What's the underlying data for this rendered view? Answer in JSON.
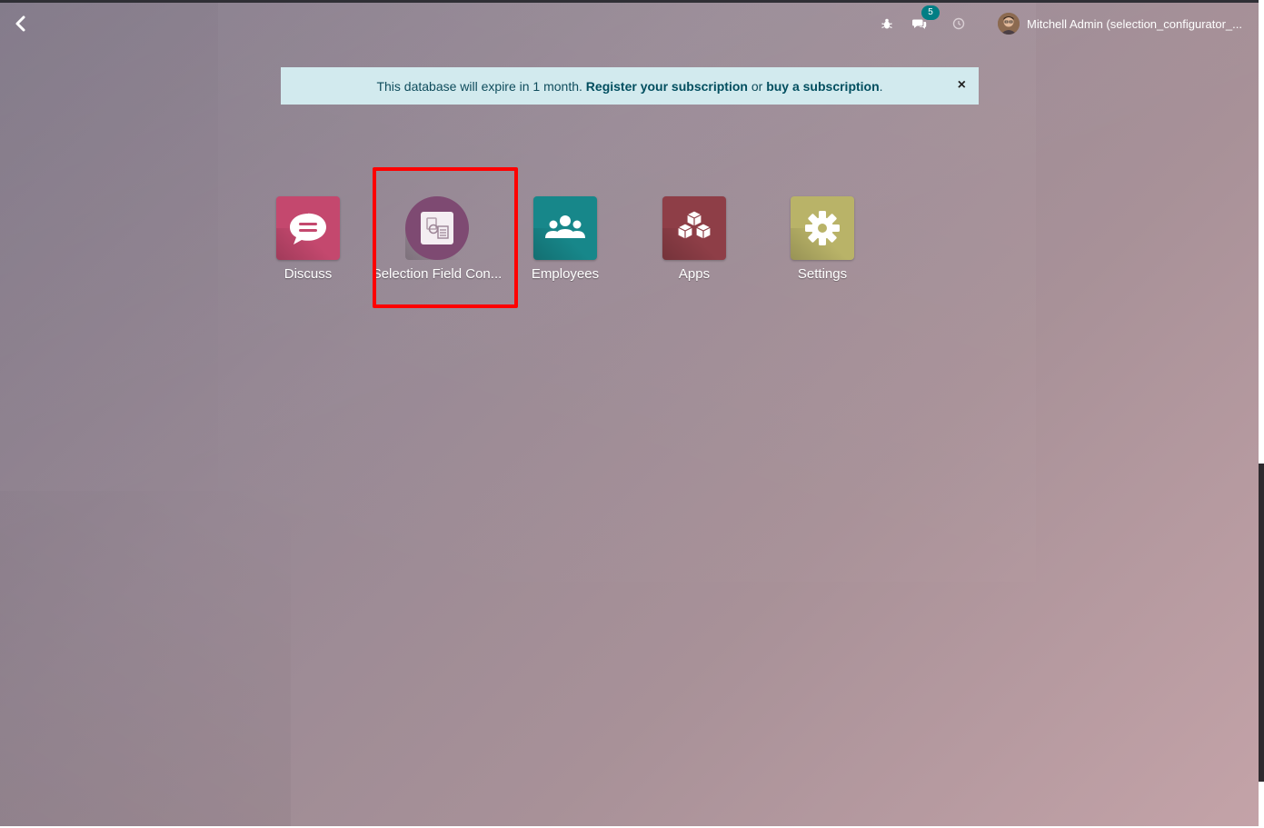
{
  "topbar": {
    "back_icon": "chevron-left-icon",
    "systray": {
      "debug_icon": "bug-icon",
      "messages_icon": "comments-icon",
      "messages_count": "5",
      "activity_icon": "clock-icon"
    },
    "user": {
      "name": "Mitchell Admin (selection_configurator_..."
    }
  },
  "alert": {
    "text_before": "This database will expire in 1 month.",
    "register_link": "Register your subscription",
    "text_or": "or",
    "buy_link": "buy a subscription",
    "text_end": ".",
    "close_label": "×"
  },
  "apps": [
    {
      "label": "Discuss",
      "color": "#c4486e",
      "icon": "chat-bubble-icon"
    },
    {
      "label": "Selection Field Con...",
      "color": "#7e4a72",
      "icon": "document-config-icon"
    },
    {
      "label": "Employees",
      "color": "#17878a",
      "icon": "users-icon"
    },
    {
      "label": "Apps",
      "color": "#8e3e47",
      "icon": "cubes-icon"
    },
    {
      "label": "Settings",
      "color": "#b9b368",
      "icon": "gear-icon"
    }
  ]
}
